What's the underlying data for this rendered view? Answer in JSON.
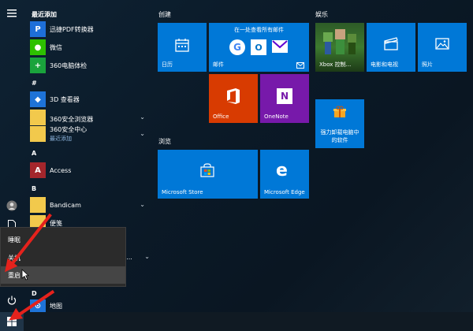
{
  "app_list": {
    "recent_header": "最近添加",
    "hash_header": "#",
    "a_header": "A",
    "b_header": "B",
    "d_header": "D",
    "items": [
      {
        "label": "迅捷PDF转换器",
        "color": "#1e6fd9",
        "icon": "pdf-icon"
      },
      {
        "label": "微信",
        "color": "#2dc100",
        "icon": "wechat-icon"
      },
      {
        "label": "360电脑体检",
        "color": "#1aa33c",
        "icon": "360-icon"
      },
      {
        "label": "3D 查看器",
        "color": "#1e73d8",
        "icon": "3d-viewer-icon"
      },
      {
        "label": "",
        "color": "#f2c94c",
        "icon": "folder-icon"
      },
      {
        "label": "360安全浏览器",
        "color": "#f2c94c",
        "icon": "folder-icon"
      },
      {
        "label": "360安全中心",
        "sub": "最近添加",
        "color": "#f2c94c",
        "icon": "folder-icon"
      },
      {
        "label": "Access",
        "color": "#a4262c",
        "icon": "access-icon"
      },
      {
        "label": "Bandicam",
        "color": "#f2c94c",
        "icon": "folder-icon"
      },
      {
        "label": "便笺",
        "color": "#f2c94c",
        "icon": "sticky-notes-icon"
      },
      {
        "label": "20...",
        "color": "#f2c94c",
        "icon": "folder-icon"
      },
      {
        "label": "地图",
        "color": "#1e73d8",
        "icon": "maps-icon"
      }
    ]
  },
  "power_menu": {
    "sleep": "睡眠",
    "shutdown": "关机",
    "restart": "重启"
  },
  "groups": {
    "create": "创建",
    "browse": "浏览",
    "entertainment": "娱乐"
  },
  "tiles": {
    "calendar": "日历",
    "mail_header": "在一处查看所有邮件",
    "mail": "邮件",
    "office": "Office",
    "onenote": "OneNote",
    "store": "Microsoft Store",
    "edge": "Microsoft Edge",
    "xbox": "Xbox 控制...",
    "movies": "电影和电视",
    "photos": "照片",
    "uninstall_line1": "强力卸载电脑中",
    "uninstall_line2": "的软件"
  },
  "colors": {
    "tile_blue": "#0078d7",
    "office_orange": "#d83b01",
    "onenote_purple": "#7719aa",
    "arrow_red": "#e5221c"
  }
}
